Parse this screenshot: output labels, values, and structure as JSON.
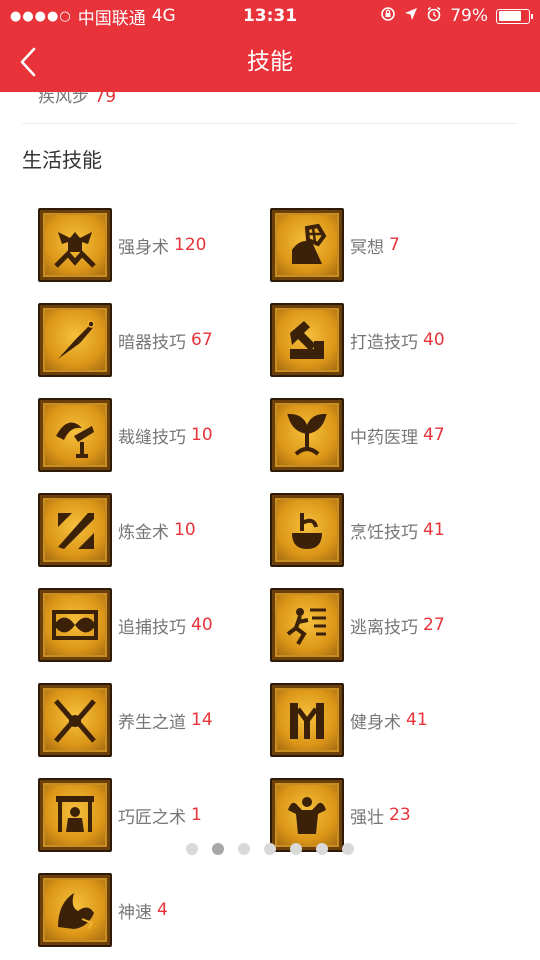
{
  "status_bar": {
    "carrier": "中国联通",
    "network": "4G",
    "time": "13:31",
    "battery": "79%",
    "battery_level": 0.79
  },
  "nav": {
    "back_icon": "chevron-left-icon",
    "title": "技能"
  },
  "previous_item": {
    "label": "疾风步",
    "value": "79"
  },
  "section": {
    "title": "生活技能"
  },
  "colors": {
    "accent": "#e8333a",
    "value_red": "#e8333a",
    "label_gray": "#777777"
  },
  "skills": [
    {
      "label": "强身术",
      "value": "120",
      "icon": "strong-body-icon"
    },
    {
      "label": "冥想",
      "value": "7",
      "icon": "meditation-icon"
    },
    {
      "label": "暗器技巧",
      "value": "67",
      "icon": "hidden-weapon-icon"
    },
    {
      "label": "打造技巧",
      "value": "40",
      "icon": "forging-icon"
    },
    {
      "label": "裁缝技巧",
      "value": "10",
      "icon": "tailoring-icon"
    },
    {
      "label": "中药医理",
      "value": "47",
      "icon": "herbal-medicine-icon"
    },
    {
      "label": "炼金术",
      "value": "10",
      "icon": "alchemy-icon"
    },
    {
      "label": "烹饪技巧",
      "value": "41",
      "icon": "cooking-icon"
    },
    {
      "label": "追捕技巧",
      "value": "40",
      "icon": "tracking-icon"
    },
    {
      "label": "逃离技巧",
      "value": "27",
      "icon": "escape-icon"
    },
    {
      "label": "养生之道",
      "value": "14",
      "icon": "health-icon"
    },
    {
      "label": "健身术",
      "value": "41",
      "icon": "fitness-icon"
    },
    {
      "label": "巧匠之术",
      "value": "1",
      "icon": "craftsman-icon"
    },
    {
      "label": "强壮",
      "value": "23",
      "icon": "muscle-icon"
    },
    {
      "label": "神速",
      "value": "4",
      "icon": "swift-icon"
    }
  ],
  "pager": {
    "count": 7,
    "active_index": 1
  }
}
